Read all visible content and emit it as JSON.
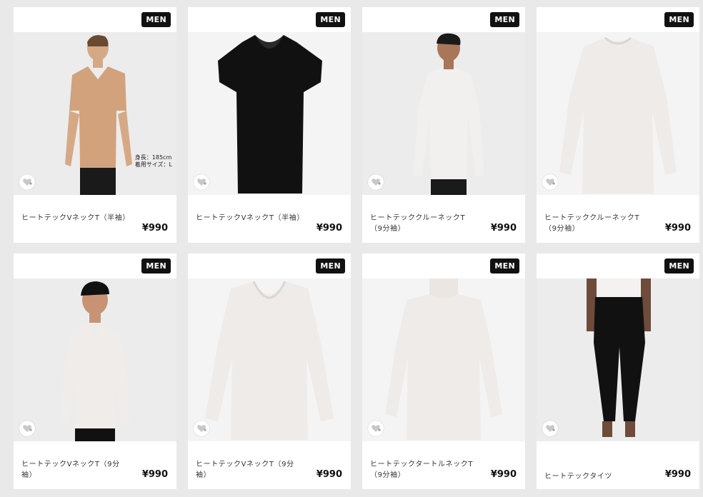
{
  "products": [
    {
      "badge": "MEN",
      "name": "ヒートテックVネックT（半袖）",
      "price": "¥990",
      "size_note": [
        "身長：185cm",
        "着用サイズ：L"
      ],
      "favorite_icon": "heart-plus-icon"
    },
    {
      "badge": "MEN",
      "name": "ヒートテックVネックT（半袖）",
      "price": "¥990",
      "favorite_icon": "heart-plus-icon"
    },
    {
      "badge": "MEN",
      "name": "ヒートテッククルーネックT（9分袖）",
      "price": "¥990",
      "favorite_icon": "heart-plus-icon"
    },
    {
      "badge": "MEN",
      "name": "ヒートテッククルーネックT（9分袖）",
      "price": "¥990",
      "favorite_icon": "heart-plus-icon"
    },
    {
      "badge": "MEN",
      "name": "ヒートテックVネックT（9分袖）",
      "price": "¥990",
      "favorite_icon": "heart-plus-icon"
    },
    {
      "badge": "MEN",
      "name": "ヒートテックVネックT（9分袖）",
      "price": "¥990",
      "favorite_icon": "heart-plus-icon"
    },
    {
      "badge": "MEN",
      "name": "ヒートテックタートルネックT（9分袖）",
      "price": "¥990",
      "favorite_icon": "heart-plus-icon"
    },
    {
      "badge": "MEN",
      "name": "ヒートテックタイツ",
      "price": "¥990",
      "favorite_icon": "heart-plus-icon"
    }
  ],
  "colors": {
    "background": "#e9e9e9",
    "card": "#ffffff",
    "badge": "#111111"
  }
}
